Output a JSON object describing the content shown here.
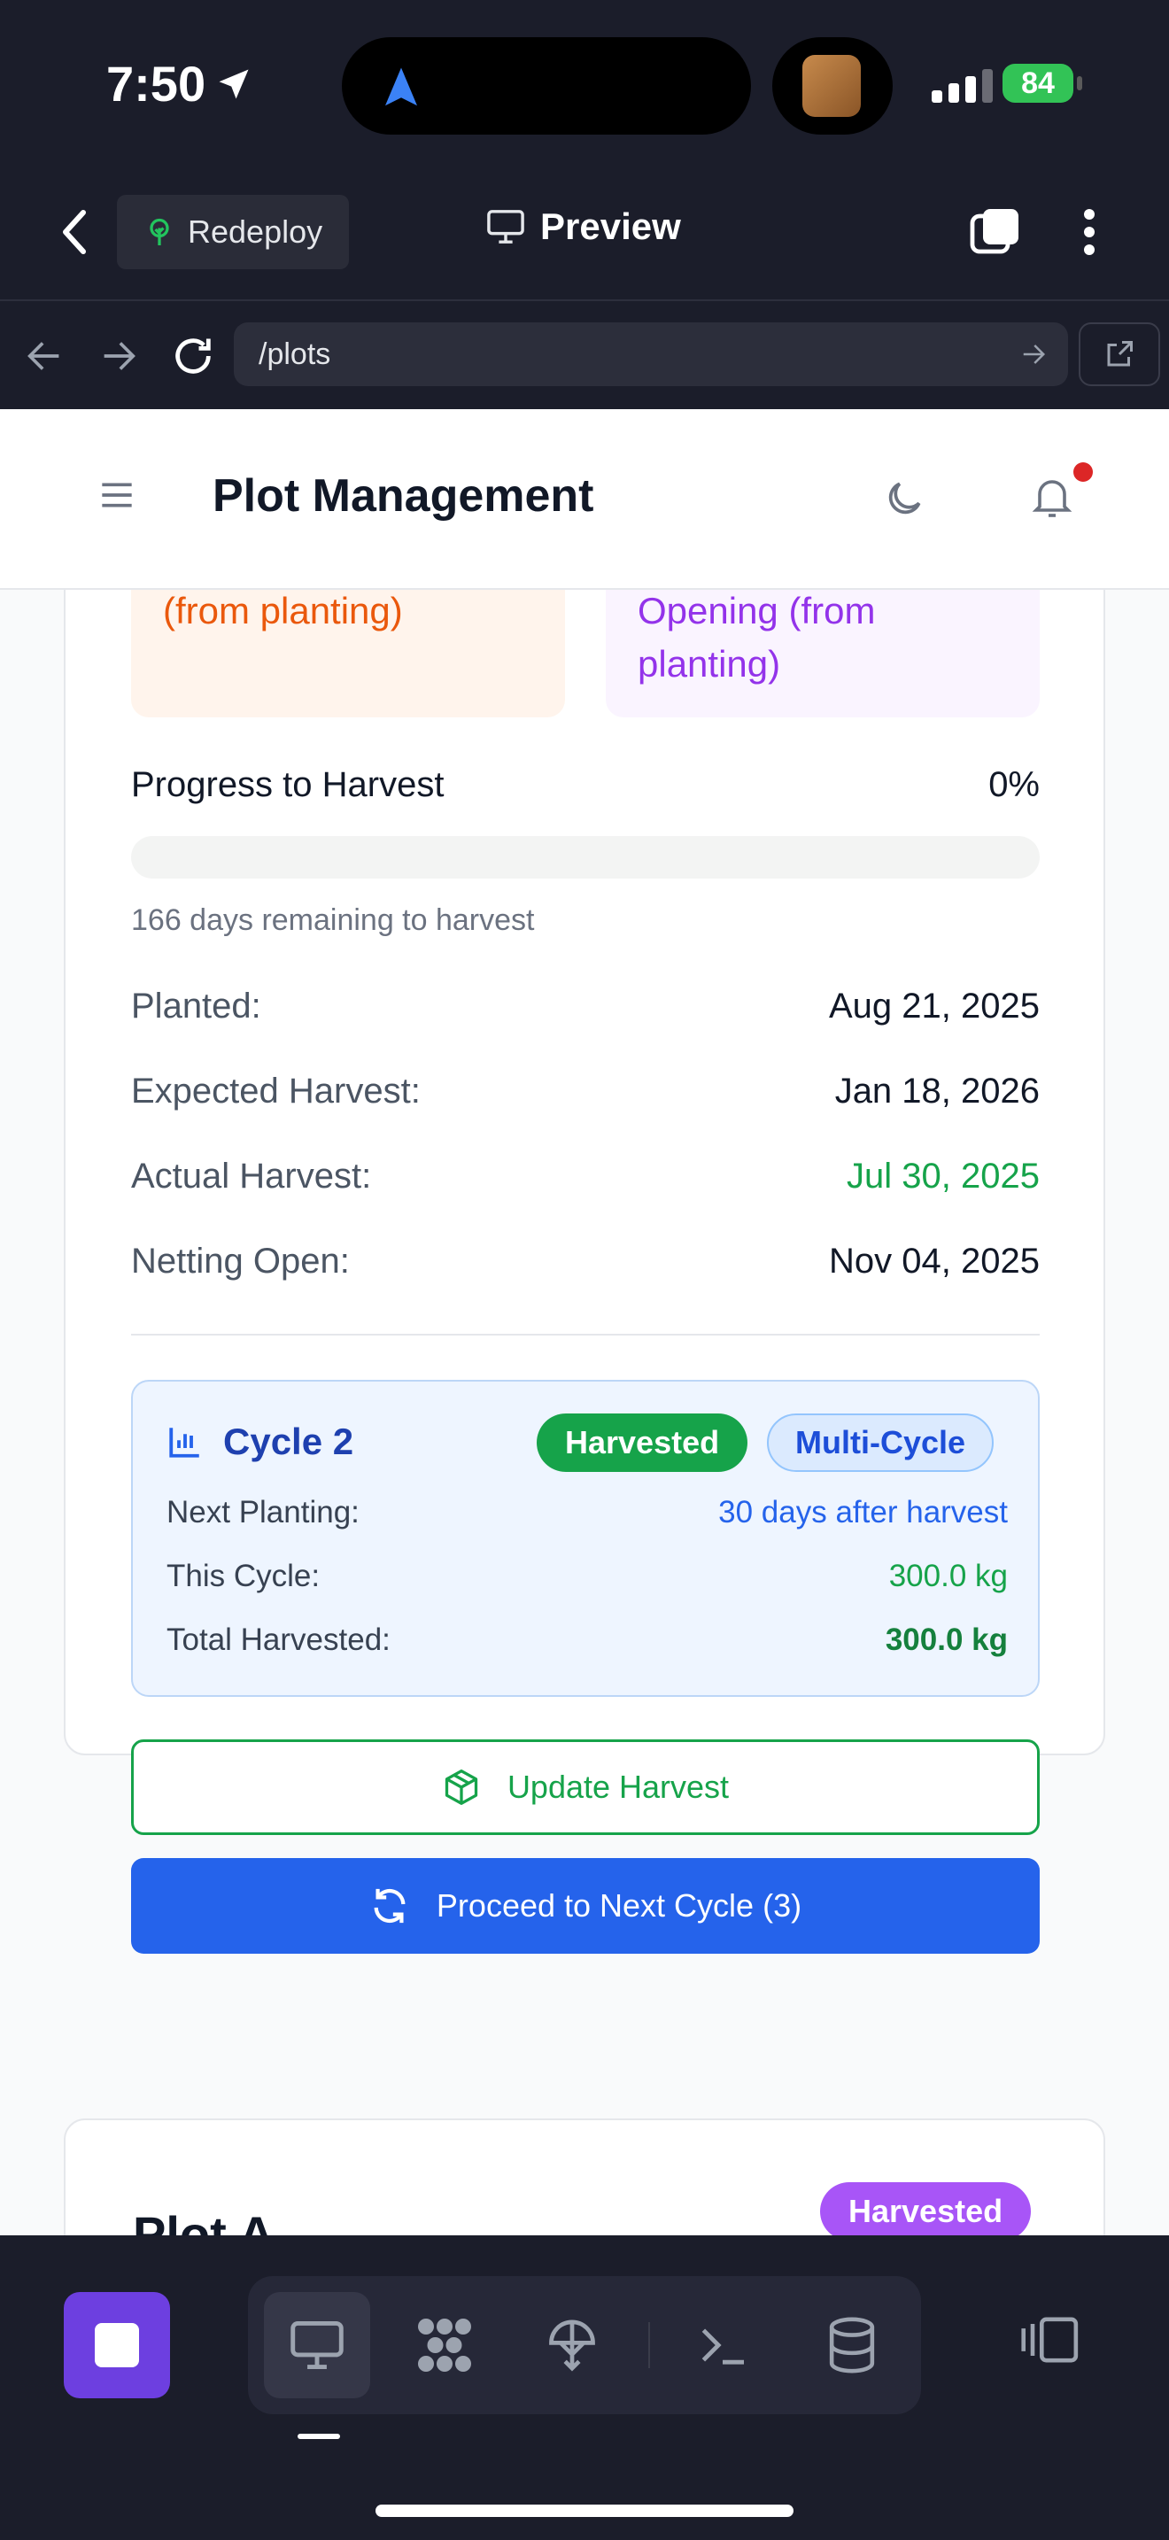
{
  "status_bar": {
    "time": "7:50",
    "battery": "84"
  },
  "ide_header": {
    "redeploy_label": "Redeploy",
    "preview_label": "Preview"
  },
  "browser": {
    "url": "/plots"
  },
  "app_header": {
    "title": "Plot Management"
  },
  "plot_card": {
    "tile_harvest": "Days Until Harvest (from planting)",
    "tile_shade": "Days Until Shade Opening (from planting)",
    "progress_label": "Progress to Harvest",
    "progress_value": "0%",
    "progress_fraction": 0,
    "remaining_text": "166 days remaining to harvest",
    "details": [
      {
        "label": "Planted:",
        "value": "Aug 21, 2025"
      },
      {
        "label": "Expected Harvest:",
        "value": "Jan 18, 2026"
      },
      {
        "label": "Actual Harvest:",
        "value": "Jul 30, 2025",
        "color": "#16a34a"
      },
      {
        "label": "Netting Open:",
        "value": "Nov 04, 2025"
      }
    ],
    "cycle": {
      "title": "Cycle 2",
      "badge_status": "Harvested",
      "badge_type": "Multi-Cycle",
      "next_planting_label": "Next Planting:",
      "next_planting_value": "30 days after harvest",
      "this_cycle_label": "This Cycle:",
      "this_cycle_value": "300.0 kg",
      "total_label": "Total Harvested:",
      "total_value": "300.0 kg"
    },
    "update_button": "Update Harvest",
    "next_cycle_button": "Proceed to Next Cycle (3)"
  },
  "plot_card_2": {
    "title": "Plot A",
    "badge": "Harvested"
  },
  "colors": {
    "accent_blue": "#2563eb",
    "accent_green": "#16a34a",
    "purple": "#a855f7",
    "orange": "#ea580c"
  }
}
